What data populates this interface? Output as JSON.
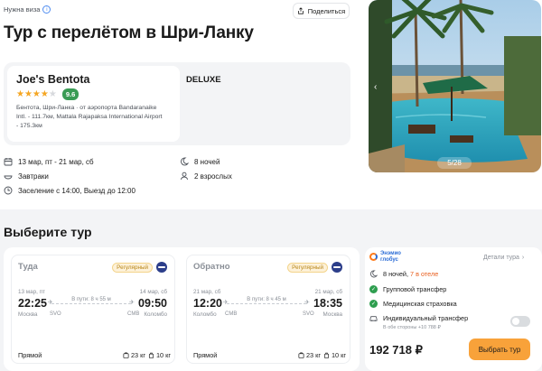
{
  "header": {
    "visa_label": "Нужна виза",
    "share_label": "Поделиться",
    "title": "Тур с перелётом в Шри-Ланку"
  },
  "hotel": {
    "name": "Joe's Bentota",
    "stars": 4,
    "max_stars": 5,
    "rating": "9.6",
    "location_line1": "Бентота, Шри-Ланка · от аэропорта Bandaranaike",
    "location_line2": "Intl. - 111.7км, Mattala Rajapaksa International Airport",
    "location_line3": "- 175.3км",
    "room_type": "DELUXE"
  },
  "trip_meta": {
    "dates": "13 мар, пт - 21 мар, сб",
    "meals": "Завтраки",
    "checkin": "Заселение с 14:00, Выезд до 12:00",
    "nights": "8 ночей",
    "guests": "2 взрослых"
  },
  "gallery": {
    "counter": "5/28"
  },
  "tours": {
    "heading": "Выберите тур",
    "outbound": {
      "title": "Туда",
      "badge": "Регулярный",
      "dep_date": "13 мар, пт",
      "dep_time": "22:25",
      "dep_city": "Москва",
      "dep_code": "SVO",
      "duration": "В пути: 8 ч 55 м",
      "arr_date": "14 мар, сб",
      "arr_time": "09:50",
      "arr_city": "Коломбо",
      "arr_code": "CMB",
      "stops": "Прямой",
      "bag1": "23 кг",
      "bag2": "10 кг"
    },
    "return": {
      "title": "Обратно",
      "badge": "Регулярный",
      "dep_date": "21 мар, сб",
      "dep_time": "12:20",
      "dep_city": "Коломбо",
      "dep_code": "CMB",
      "duration": "В пути: 8 ч 45 м",
      "arr_date": "21 мар, сб",
      "arr_time": "18:35",
      "arr_city": "Москва",
      "arr_code": "SVO",
      "stops": "Прямой",
      "bag1": "23 кг",
      "bag2": "10 кг"
    }
  },
  "offer": {
    "operator_line1": "Энэмио",
    "operator_line2": "глобус",
    "details_label": "Детали тура",
    "nights_text": "8 ночей, ",
    "nights_hotel": "7 в отеле",
    "feature1": "Групповой трансфер",
    "feature2": "Медицинская страховка",
    "individual_transfer": "Индивидуальный трансфер",
    "individual_transfer_sub": "В обе стороны +10 788 ₽",
    "price": "192 718 ₽",
    "choose_label": "Выбрать тур"
  },
  "colors": {
    "accent": "#f8a23a",
    "rating": "#3a9c55",
    "star": "#f5a623",
    "check": "#2e9e4f",
    "highlight": "#e85d1c"
  }
}
